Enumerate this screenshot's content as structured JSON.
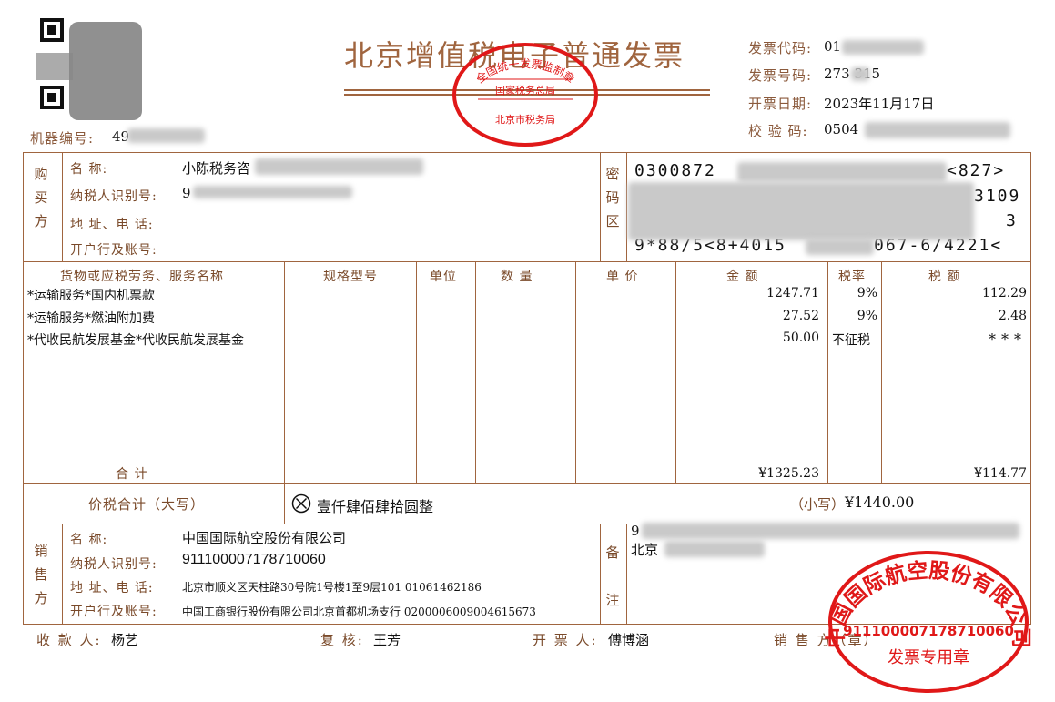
{
  "invoice": {
    "title": "北京增值税电子普通发票",
    "machine_no_label": "机器编号:",
    "machine_no": "49",
    "code_label": "发票代码:",
    "code": "01",
    "number_label": "发票号码:",
    "number": "273  315",
    "date_label": "开票日期:",
    "date": "2023年11月17日",
    "check_label": "校 验 码:",
    "check": "0504"
  },
  "buyer": {
    "section": [
      "购",
      "买",
      "方"
    ],
    "name_label": "名      称:",
    "name": "小陈税务咨",
    "taxid_label": "纳税人识别号:",
    "taxid": "9",
    "addr_label": "地 址、电 话:",
    "bank_label": "开户行及账号:"
  },
  "cipher": {
    "section": [
      "密",
      "码",
      "区"
    ],
    "line1": "0300872",
    "line1b": "<827>",
    "line2b": "3109",
    "line3a": "0",
    "line3b": "3",
    "line4": "9*88/5<8+4015",
    "line4b": "067-6/4221<"
  },
  "columns": {
    "goods": "货物或应税劳务、服务名称",
    "spec": "规格型号",
    "unit": "单位",
    "qty": "数  量",
    "price": "单  价",
    "amount": "金  额",
    "rate": "税率",
    "tax": "税  额"
  },
  "items": [
    {
      "name": "*运输服务*国内机票款",
      "amount": "1247.71",
      "rate": "9%",
      "tax": "112.29"
    },
    {
      "name": "*运输服务*燃油附加费",
      "amount": "27.52",
      "rate": "9%",
      "tax": "2.48"
    },
    {
      "name": "*代收民航发展基金*代收民航发展基金",
      "amount": "50.00",
      "rate": "不征税",
      "tax": "***"
    }
  ],
  "totals": {
    "label": "合        计",
    "amount": "¥1325.23",
    "tax": "¥114.77",
    "big_label": "价税合计（大写）",
    "big_icon": "circle-x-icon",
    "big_value": "壹仟肆佰肆拾圆整",
    "small_label": "（小写）",
    "small_value": "¥1440.00"
  },
  "seller": {
    "section": [
      "销",
      "售",
      "方"
    ],
    "name_label": "名      称:",
    "name": "中国国际航空股份有限公司",
    "taxid_label": "纳税人识别号:",
    "taxid": "911100007178710060",
    "addr_label": "地 址、电 话:",
    "addr": "北京市顺义区天柱路30号院1号楼1至9层101 01061462186",
    "bank_label": "开户行及账号:",
    "bank": "中国工商银行股份有限公司北京首都机场支行 0200006009004615673"
  },
  "remarks": {
    "section": [
      "备",
      "注"
    ],
    "line1": "9",
    "line2": "北京"
  },
  "footer": {
    "payee_label": "收 款 人:",
    "payee": "杨艺",
    "reviewer_label": "复  核:",
    "reviewer": "王芳",
    "drawer_label": "开 票 人:",
    "drawer": "傅博涵",
    "seller_label": "销  售  方（章）"
  },
  "stamps": {
    "tax_top": "全国统一发票监制章",
    "tax_mid": "国家税务总局",
    "tax_bottom": "北京市税务局",
    "company_arc": "中国国际航空股份有限公司",
    "company_id": "911100007178710060",
    "company_bottom": "发票专用章",
    "color": "#e01818"
  }
}
